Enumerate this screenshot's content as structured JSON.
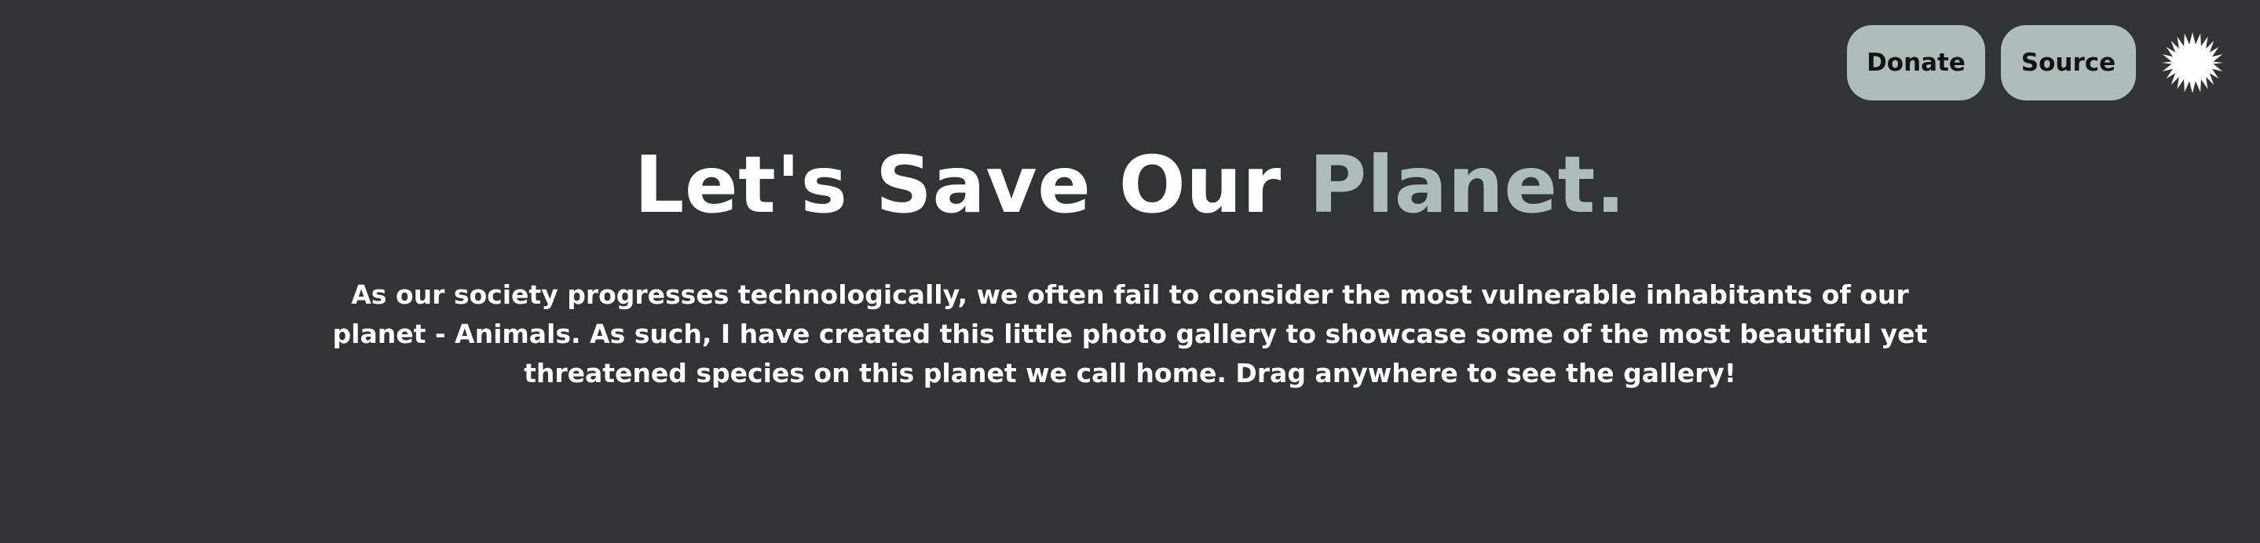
{
  "header": {
    "donate_label": "Donate",
    "source_label": "Source",
    "theme_toggle_icon": "sun-icon",
    "button_color": "#aebdb9"
  },
  "hero": {
    "title_main": "Let's Save Our ",
    "title_accent": "Planet.",
    "accent_color": "#aebdb9",
    "description": "As our society progresses technologically, we often fail to consider the most vulnerable inhabitants of our planet - Animals. As such, I have created this little photo gallery to showcase some of the most beautiful yet threatened species on this planet we call home. Drag anywhere to see the gallery!"
  },
  "page": {
    "background_color": "#303434"
  }
}
